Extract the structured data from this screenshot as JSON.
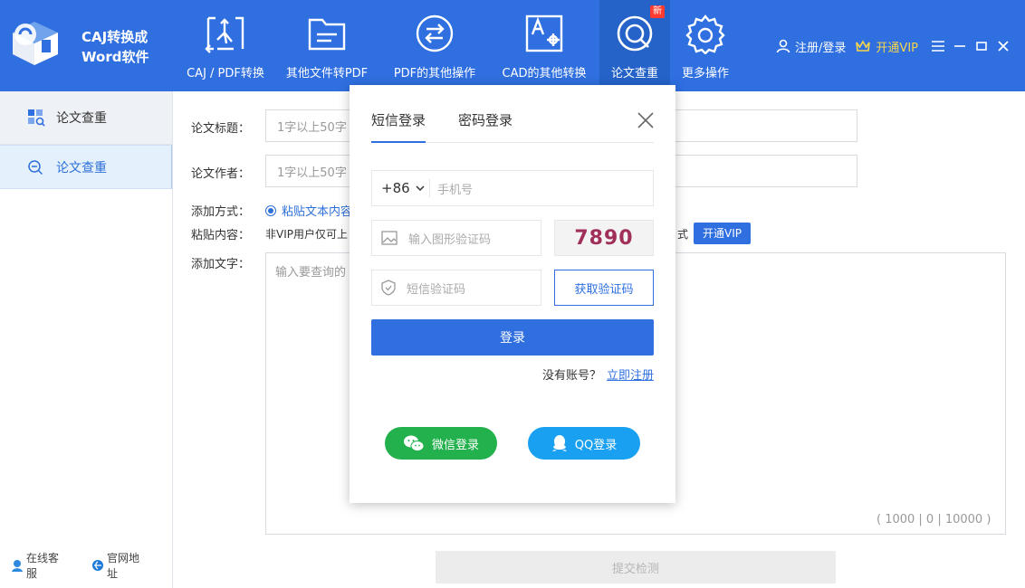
{
  "app": {
    "title_line1": "CAJ转换成",
    "title_line2": "Word软件"
  },
  "toolbar": [
    {
      "label": "CAJ / PDF转换",
      "icon": "pdf-convert-icon"
    },
    {
      "label": "其他文件转PDF",
      "icon": "folder-icon"
    },
    {
      "label": "PDF的其他操作",
      "icon": "swap-arrows-icon"
    },
    {
      "label": "CAD的其他转换",
      "icon": "cad-icon"
    },
    {
      "label": "论文查重",
      "icon": "plagiarism-check-icon",
      "badge": "新"
    },
    {
      "label": "更多操作",
      "icon": "gear-icon"
    }
  ],
  "user": {
    "login_label": "注册/登录",
    "vip_label": "开通VIP"
  },
  "sidebar": {
    "header": "论文查重",
    "item": "论文查重",
    "footer_service": "在线客服",
    "footer_site": "官网地址"
  },
  "form": {
    "title_label": "论文标题：",
    "title_placeholder": "1字以上50字",
    "author_label": "论文作者：",
    "author_placeholder": "1字以上50字",
    "method_label": "添加方式：",
    "method_option": "粘贴文本内容",
    "paste_label": "粘贴内容：",
    "paste_note": "非VIP用户仅可上",
    "paste_note_tail": "式",
    "vip_button": "开通VIP",
    "text_label": "添加文字：",
    "text_placeholder": "输入要查询的",
    "counter": "( 1000 | 0 | 10000 )",
    "submit": "提交检测"
  },
  "modal": {
    "tab_sms": "短信登录",
    "tab_password": "密码登录",
    "country_code": "+86",
    "phone_placeholder": "手机号",
    "captcha_placeholder": "输入图形验证码",
    "captcha_text": "7890",
    "sms_placeholder": "短信验证码",
    "get_code": "获取验证码",
    "login": "登录",
    "no_account": "没有账号？",
    "register_now": "立即注册",
    "wechat_login": "微信登录",
    "qq_login": "QQ登录"
  },
  "colors": {
    "brand": "#2f6fe0",
    "wechat": "#22b14c",
    "qq": "#1aa0f0",
    "captcha": "#a0305a"
  }
}
